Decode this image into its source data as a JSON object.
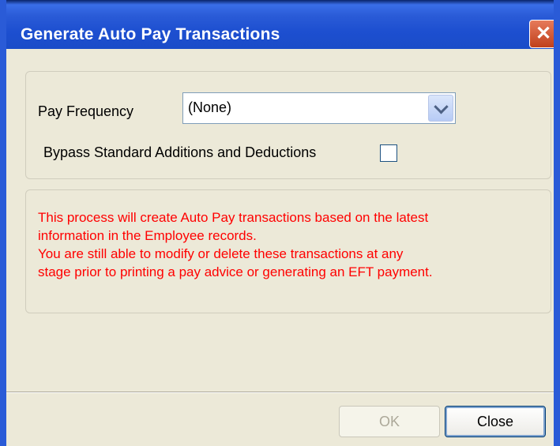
{
  "window": {
    "title": "Generate Auto Pay Transactions",
    "close_glyph": "✕"
  },
  "form": {
    "pay_frequency_label": "Pay Frequency",
    "pay_frequency_value": "(None)",
    "bypass_label": "Bypass Standard Additions and Deductions",
    "bypass_checked": false
  },
  "message": {
    "lines": [
      "This process will create Auto Pay transactions based on the latest",
      "information in the Employee records.",
      "You are still able to modify or delete these transactions at any",
      "stage prior to printing a pay advice or generating an EFT payment."
    ],
    "color": "#ff0000"
  },
  "buttons": {
    "ok": "OK",
    "close": "Close"
  }
}
